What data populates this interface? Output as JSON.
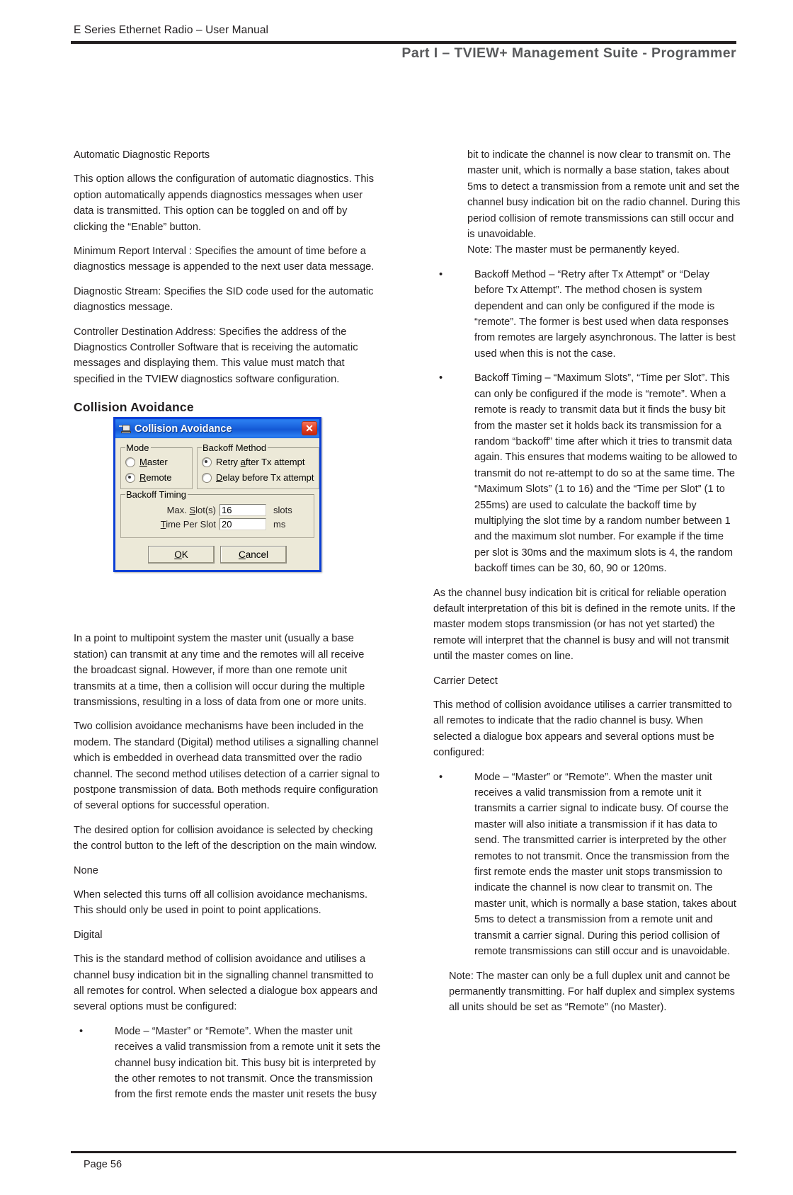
{
  "header": {
    "running_head": "E Series Ethernet Radio – User Manual",
    "part_title": "Part I – TVIEW+ Management Suite - Programmer"
  },
  "footer": {
    "page_label": "Page 56"
  },
  "left_column": {
    "subhead_auto_diag": "Automatic Diagnostic Reports",
    "p_auto_diag": "This option allows the configuration of automatic diagnostics. This option automatically appends diagnostics messages when user data is transmitted. This option can be toggled on and off by clicking the “Enable” button.",
    "p_min_report": "Minimum Report Interval : Specifies the amount of time before a diagnostics message is appended to the next user data message.",
    "p_diag_stream": "Diagnostic Stream: Specifies the SID code used for the automatic diagnostics message.",
    "p_controller_addr": "Controller Destination Address: Specifies the address of the Diagnostics Controller Software that is receiving the automatic messages and displaying them. This value must match that specified in the TVIEW diagnostics software configuration.",
    "heading_collision": "Collision Avoidance",
    "p_point_to_multipoint": "In a point to multipoint system the master unit (usually a base station) can transmit at any time and the remotes will all receive the broadcast signal.  However, if more than one remote unit transmits at a time, then a collision will occur during the multiple transmissions, resulting in a loss of data from one or more units.",
    "p_two_mechanisms": "Two collision avoidance mechanisms have been included in the modem.  The standard (Digital) method utilises a signalling channel which is embedded in overhead data transmitted over the radio channel. The second method utilises detection of a carrier signal to postpone transmission of data. Both methods require configuration of several options for successful operation.",
    "p_desired_option": "The desired option for collision avoidance is selected by checking the control button to the left of the description on the main window.",
    "subhead_none": "None",
    "p_none": "When selected this turns off all collision avoidance mechanisms. This should only be used in point to point applications.",
    "subhead_digital": "Digital",
    "p_digital": "This is the standard method of collision avoidance and utilises a channel busy indication bit in the signalling channel transmitted to all remotes for control. When selected a dialogue box appears and several options must be configured:",
    "bullet_mode_digital": "Mode – “Master” or “Remote”. When the master unit receives a valid transmission from a remote unit it sets the channel busy indication bit. This busy bit is interpreted by the other remotes to not transmit. Once the transmission from the first remote ends the master unit resets the busy",
    "bullet_char": "•"
  },
  "right_column": {
    "p_continued": "bit to indicate the channel is now clear to transmit on. The master unit, which is normally a base station, takes about 5ms to detect a transmission from a remote unit and set the channel busy indication bit on the radio channel. During this period collision of remote transmissions can still occur and is unavoidable.",
    "p_note_keyed": "Note: The master must be permanently keyed.",
    "bullet_backoff_method": "Backoff Method – “Retry after Tx Attempt” or “Delay before Tx Attempt”. The method chosen is system dependent and can only be configured if the mode is “remote”. The former is best used when data responses from remotes are largely asynchronous. The latter is best used when this is not the case.",
    "bullet_backoff_timing": "Backoff Timing – “Maximum Slots”, “Time per Slot”. This can only be configured if the mode is “remote”. When a remote is ready to transmit data but it finds the busy bit from the master set it holds back its transmission for a random “backoff” time after which it tries to transmit data again. This ensures that modems waiting to be allowed to transmit do not re-attempt to do so at the same time. The “Maximum Slots” (1 to 16) and the “Time per Slot” (1 to 255ms) are used to calculate the backoff time by multiplying the slot time by a random number between 1 and the maximum slot number. For example if the time per slot is 30ms and the maximum slots is 4, the random backoff times can be 30, 60, 90 or 120ms.",
    "p_channel_busy_critical": "As the channel busy indication bit is critical for reliable operation default interpretation of this bit is defined in the remote units. If the master modem stops transmission (or has not yet started) the remote will interpret that the channel is busy and will not transmit until the master comes on line.",
    "subhead_carrier_detect": "Carrier Detect",
    "p_carrier_detect": "This method of collision avoidance utilises a carrier transmitted to all remotes to indicate that the radio channel is busy. When selected a dialogue box appears and several options must be configured:",
    "bullet_mode_carrier": "Mode – “Master” or “Remote”. When the master unit receives a valid transmission from a remote unit it transmits a carrier signal to indicate busy. Of course the master will also initiate a transmission if it has data to send. The transmitted carrier is interpreted by the other remotes to not transmit. Once the transmission from the first remote ends the master unit stops transmission to indicate the channel is now clear to transmit on. The master unit, which is normally a base station, takes about 5ms to detect a transmission from a remote unit and transmit a carrier signal. During this period collision of remote transmissions can still occur and is unavoidable.",
    "p_note_duplex": "Note: The master can only be a full duplex unit and cannot be permanently transmitting. For half duplex and simplex systems all units should be set as “Remote” (no Master)."
  },
  "dialog": {
    "title": "Collision Avoidance",
    "close_label": "✕",
    "mode_group_label": "Mode",
    "mode_options": [
      {
        "label_pre": "",
        "label_accel": "M",
        "label_post": "aster",
        "selected": false
      },
      {
        "label_pre": "",
        "label_accel": "R",
        "label_post": "emote",
        "selected": true
      }
    ],
    "backoff_method_group_label": "Backoff Method",
    "backoff_method_options": [
      {
        "label_pre": "Retry ",
        "label_accel": "a",
        "label_post": "fter Tx attempt",
        "selected": true
      },
      {
        "label_pre": "",
        "label_accel": "D",
        "label_post": "elay before Tx attempt",
        "selected": false
      }
    ],
    "backoff_timing_group_label_pre": "Backoff Timin",
    "backoff_timing_group_label_accel": "g",
    "max_slots_label_pre": "Max. ",
    "max_slots_label_accel": "S",
    "max_slots_label_post": "lot(s)",
    "max_slots_value": "16",
    "max_slots_unit": "slots",
    "time_per_slot_label_accel": "T",
    "time_per_slot_label_post": "ime Per Slot",
    "time_per_slot_value": "20",
    "time_per_slot_unit": "ms",
    "ok_label_accel": "O",
    "ok_label_post": "K",
    "cancel_label_accel": "C",
    "cancel_label_post": "ancel"
  }
}
